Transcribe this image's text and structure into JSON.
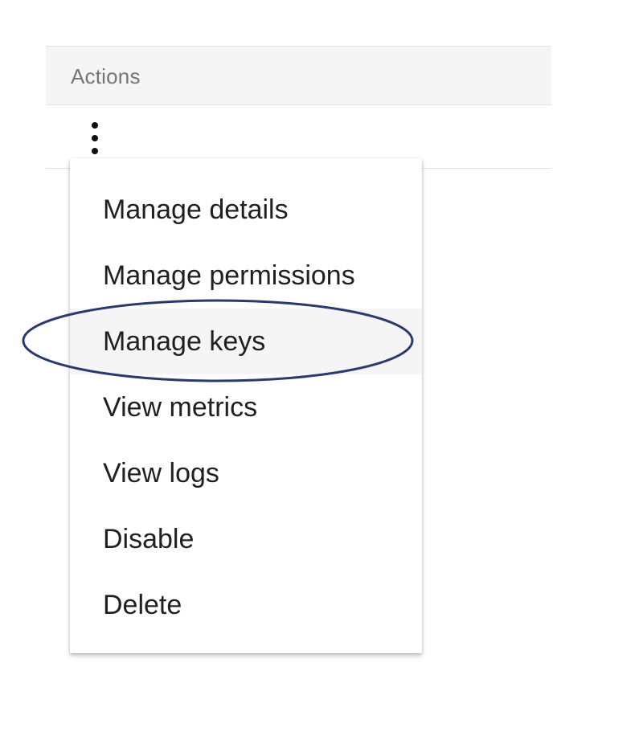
{
  "table": {
    "header": {
      "actions_label": "Actions"
    }
  },
  "row": {
    "more_actions_icon": "more-vert-icon"
  },
  "menu": {
    "items": [
      {
        "label": "Manage details"
      },
      {
        "label": "Manage permissions"
      },
      {
        "label": "Manage keys",
        "highlighted": true
      },
      {
        "label": "View metrics"
      },
      {
        "label": "View logs"
      },
      {
        "label": "Disable"
      },
      {
        "label": "Delete"
      }
    ]
  },
  "annotation": {
    "target": "Manage keys",
    "stroke_color": "#2b3a6e"
  },
  "colors": {
    "header_bg": "#f5f5f5",
    "header_text": "#757575",
    "menu_text": "#202020",
    "highlight_bg": "#f5f5f5"
  }
}
